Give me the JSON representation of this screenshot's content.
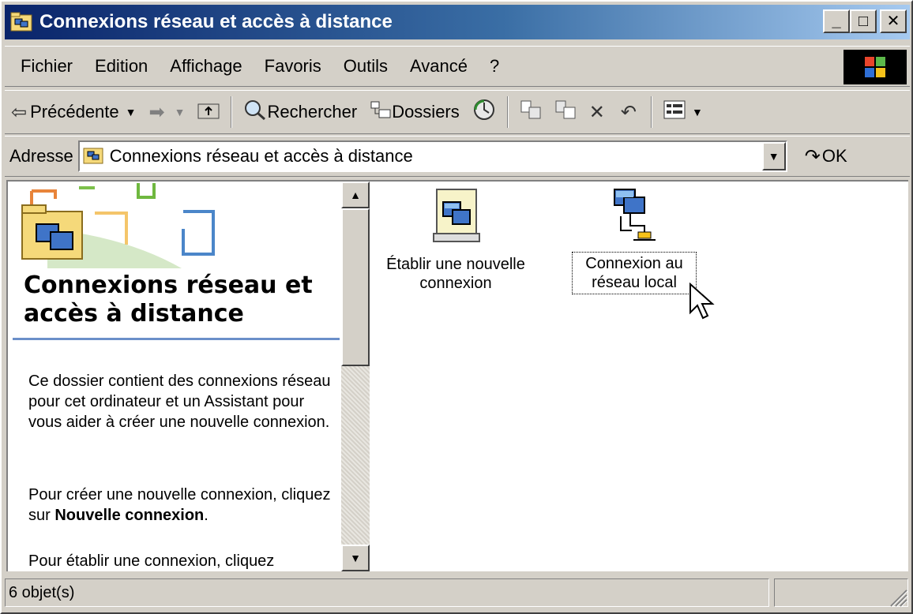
{
  "window": {
    "title": "Connexions réseau et accès à distance",
    "minimize_glyph": "_",
    "maximize_glyph": "□",
    "close_glyph": "✕"
  },
  "menu": [
    "Fichier",
    "Edition",
    "Affichage",
    "Favoris",
    "Outils",
    "Avancé",
    "?"
  ],
  "toolbar": {
    "back_label": "Précédente",
    "search_label": "Rechercher",
    "folders_label": "Dossiers"
  },
  "address": {
    "label": "Adresse",
    "value": "Connexions réseau et accès à distance",
    "go_label": "OK"
  },
  "left_panel": {
    "heading": "Connexions réseau et accès à distance",
    "para1": "Ce dossier contient des connexions réseau pour cet ordinateur et un Assistant pour vous aider à créer une nouvelle connexion.",
    "para2_prefix": "Pour créer une nouvelle connexion, cliquez sur ",
    "para2_bold": "Nouvelle connexion",
    "para2_suffix": ".",
    "para3": "Pour établir une connexion, cliquez"
  },
  "items": [
    {
      "label": "Établir une nouvelle connexion",
      "icon": "new-connection-wizard-icon",
      "selected": false
    },
    {
      "label": "Connexion au réseau local",
      "icon": "lan-connection-icon",
      "selected": true
    }
  ],
  "status": {
    "count": "6 objet(s)"
  },
  "colors": {
    "title_start": "#0a246a",
    "title_end": "#a6caf0",
    "face": "#d4d0c8",
    "panel_rule": "#6b8fc9"
  }
}
